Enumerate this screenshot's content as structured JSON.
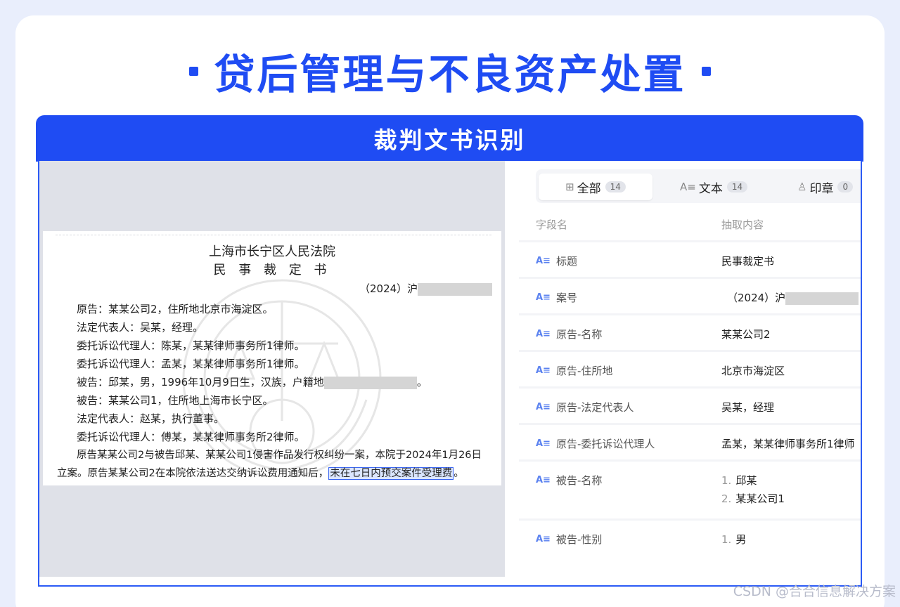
{
  "header": {
    "title": "贷后管理与不良资产处置"
  },
  "banner": {
    "title": "裁判文书识别"
  },
  "document": {
    "court": "上海市长宁区人民法院",
    "doc_type": "民 事 裁 定 书",
    "case_no_prefix": "（2024）沪",
    "lines": [
      "原告：某某公司2，住所地北京市海淀区。",
      "法定代表人：吴某，经理。",
      "委托诉讼代理人：陈某，某某律师事务所1律师。",
      "委托诉讼代理人：孟某，某某律师事务所1律师。",
      "被告：邱某，男，1996年10月9日生，汉族，户籍地",
      "被告：某某公司1，住所地上海市长宁区。",
      "法定代表人：赵某，执行董事。",
      "委托诉讼代理人：傅某，某某律师事务所2律师。",
      "原告某某公司2与被告邱某、某某公司1侵害作品发行权纠纷一案，本院于2024年1月26日"
    ],
    "line_last_prefix": "立案。原告某某公司2在本院依法送达交纳诉讼费用通知后，",
    "line_last_highlight": "未在七日内预交案件受理费",
    "line_last_suffix": "。",
    "line5_suffix": "。"
  },
  "tabs": [
    {
      "icon": "grid-icon",
      "glyph": "⊞",
      "label": "全部",
      "count": "14"
    },
    {
      "icon": "text-icon",
      "glyph": "A≡",
      "label": "文本",
      "count": "14"
    },
    {
      "icon": "stamp-icon",
      "glyph": "♙",
      "label": "印章",
      "count": "0"
    }
  ],
  "table": {
    "col_field": "字段名",
    "col_value": "抽取内容",
    "rows": [
      {
        "field": "标题",
        "values": [
          "民事裁定书"
        ]
      },
      {
        "field": "案号",
        "values": [
          "（2024）沪"
        ]
      },
      {
        "field": "原告-名称",
        "values": [
          "某某公司2"
        ]
      },
      {
        "field": "原告-住所地",
        "values": [
          "北京市海淀区"
        ]
      },
      {
        "field": "原告-法定代表人",
        "values": [
          "吴某，经理"
        ]
      },
      {
        "field": "原告-委托诉讼代理人",
        "values": [
          "孟某，某某律师事务所1律师"
        ]
      },
      {
        "field": "被告-名称",
        "values": [
          "邱某",
          "某某公司1"
        ],
        "nums": [
          "1.",
          "2."
        ]
      },
      {
        "field": "被告-性别",
        "values": [
          "男"
        ],
        "nums": [
          "1."
        ]
      }
    ]
  },
  "watermark": "CSDN @合合信息解决方案",
  "colors": {
    "accent": "#1f4cf3",
    "highlight_border": "#3a66f2"
  }
}
